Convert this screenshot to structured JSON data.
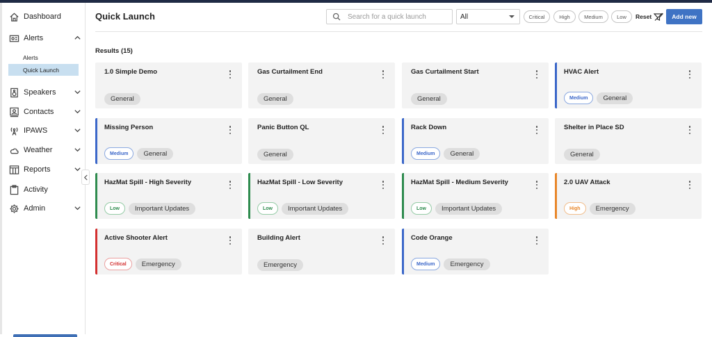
{
  "sidebar": {
    "items": [
      {
        "label": "Dashboard",
        "icon": "home-icon"
      },
      {
        "label": "Alerts",
        "icon": "alerts-icon",
        "expanded": true
      },
      {
        "label": "Speakers",
        "icon": "speaker-icon"
      },
      {
        "label": "Contacts",
        "icon": "contacts-icon"
      },
      {
        "label": "IPAWS",
        "icon": "broadcast-icon"
      },
      {
        "label": "Weather",
        "icon": "cloud-icon"
      },
      {
        "label": "Reports",
        "icon": "reports-icon"
      },
      {
        "label": "Activity",
        "icon": "clipboard-icon"
      },
      {
        "label": "Admin",
        "icon": "gear-icon"
      }
    ],
    "subitems": [
      {
        "label": "Alerts"
      },
      {
        "label": "Quick Launch",
        "active": true
      }
    ]
  },
  "header": {
    "title": "Quick Launch",
    "search_placeholder": "Search for a quick launch",
    "filter_value": "All",
    "severity_filters": [
      "Critical",
      "High",
      "Medium",
      "Low"
    ],
    "reset_label": "Reset",
    "add_new_label": "Add new"
  },
  "results_label": "Results (15)",
  "colors": {
    "critical": "#d32f2f",
    "high": "#e8872a",
    "medium": "#3b67c9",
    "low": "#2e8b4e",
    "accent": "#3f73c4"
  },
  "cards": [
    {
      "title": "1.0 Simple Demo",
      "severity": "",
      "category": "General"
    },
    {
      "title": "Gas Curtailment End",
      "severity": "",
      "category": "General"
    },
    {
      "title": "Gas Curtailment Start",
      "severity": "",
      "category": "General"
    },
    {
      "title": "HVAC Alert",
      "severity": "Medium",
      "category": "General"
    },
    {
      "title": "Missing Person",
      "severity": "Medium",
      "category": "General"
    },
    {
      "title": "Panic Button QL",
      "severity": "",
      "category": "General"
    },
    {
      "title": "Rack Down",
      "severity": "Medium",
      "category": "General"
    },
    {
      "title": "Shelter in Place SD",
      "severity": "",
      "category": "General"
    },
    {
      "title": "HazMat Spill - High Severity",
      "severity": "Low",
      "category": "Important Updates"
    },
    {
      "title": "HazMat Spill - Low Severity",
      "severity": "Low",
      "category": "Important Updates"
    },
    {
      "title": "HazMat Spill - Medium Severity",
      "severity": "Low",
      "category": "Important Updates"
    },
    {
      "title": "2.0 UAV Attack",
      "severity": "High",
      "category": "Emergency"
    },
    {
      "title": "Active Shooter Alert",
      "severity": "Critical",
      "category": "Emergency"
    },
    {
      "title": "Building Alert",
      "severity": "",
      "category": "Emergency"
    },
    {
      "title": "Code Orange",
      "severity": "Medium",
      "category": "Emergency"
    }
  ]
}
